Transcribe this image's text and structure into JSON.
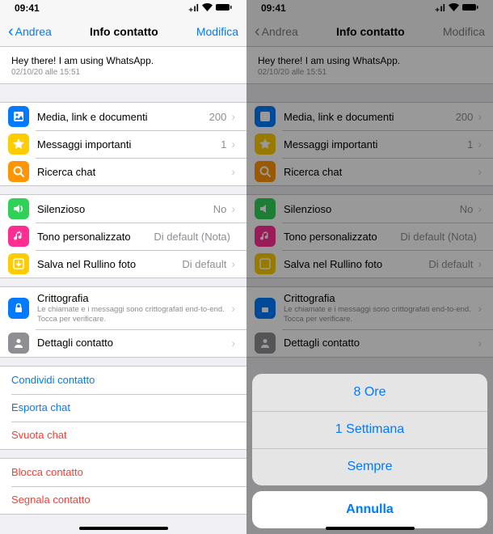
{
  "status": {
    "time": "09:41",
    "signal": "∎∎∎",
    "wifi": "▲",
    "battery": "■"
  },
  "nav": {
    "back": "Andrea",
    "title": "Info contatto",
    "edit": "Modifica"
  },
  "about": {
    "text": "Hey there! I am using WhatsApp.",
    "ts": "02/10/20 alle 15:51"
  },
  "rows": {
    "media": {
      "label": "Media, link e documenti",
      "value": "200"
    },
    "starred": {
      "label": "Messaggi importanti",
      "value": "1"
    },
    "search": {
      "label": "Ricerca chat"
    },
    "mute": {
      "label": "Silenzioso",
      "value": "No"
    },
    "tone": {
      "label": "Tono personalizzato",
      "value": "Di default (Nota)"
    },
    "save": {
      "label": "Salva nel Rullino foto",
      "value": "Di default"
    },
    "crypto": {
      "label": "Crittografia",
      "sub": "Le chiamate e i messaggi sono crittografati end-to-end. Tocca per verificare."
    },
    "details": {
      "label": "Dettagli contatto"
    }
  },
  "actions": {
    "share": "Condividi contatto",
    "export": "Esporta chat",
    "clear": "Svuota chat",
    "block": "Blocca contatto",
    "report": "Segnala contatto"
  },
  "sheet": {
    "opt1": "8 Ore",
    "opt2": "1 Settimana",
    "opt3": "Sempre",
    "cancel": "Annulla"
  }
}
